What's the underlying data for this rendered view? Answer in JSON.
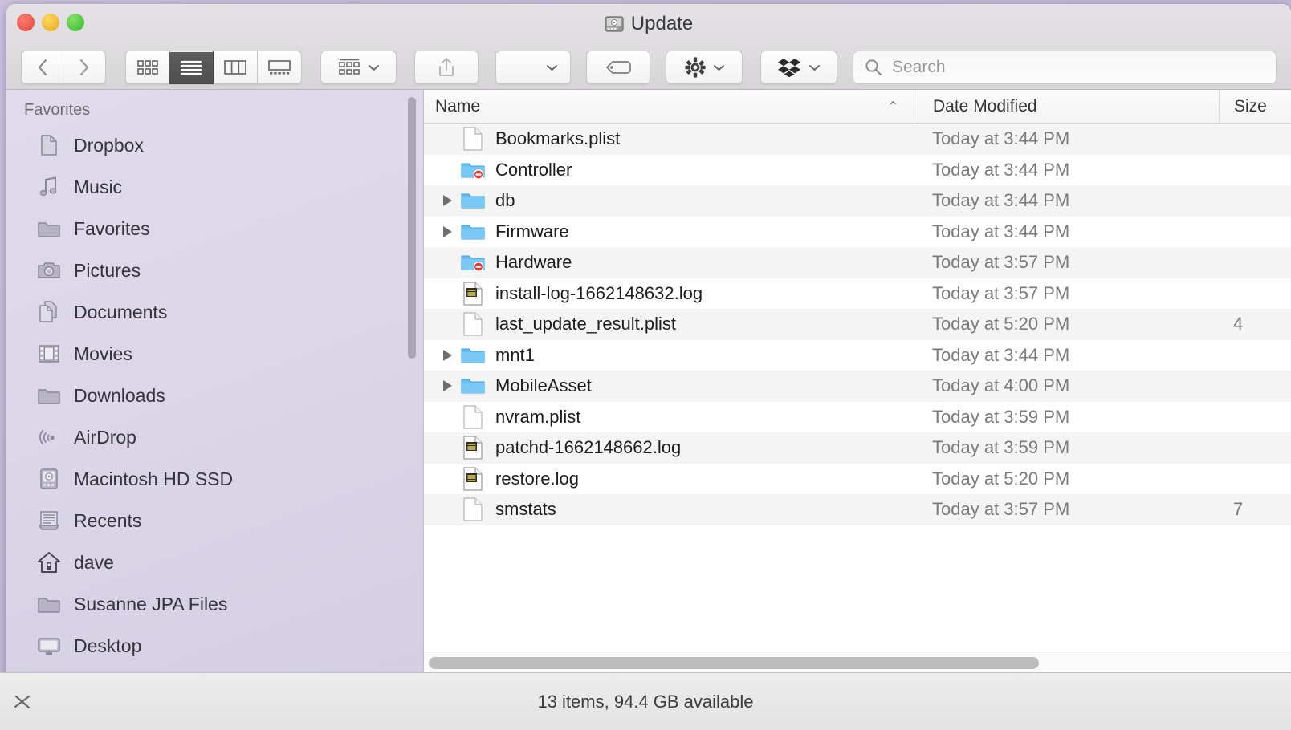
{
  "window": {
    "title": "Update",
    "title_icon": "hard-drive-icon",
    "traffic_lights": [
      "close",
      "minimize",
      "zoom"
    ]
  },
  "toolbar": {
    "back_label": "‹",
    "forward_label": "›",
    "view_modes": [
      {
        "name": "icon-view",
        "active": false
      },
      {
        "name": "list-view",
        "active": true
      },
      {
        "name": "column-view",
        "active": false
      },
      {
        "name": "gallery-view",
        "active": false
      }
    ],
    "arrange_label": "",
    "share_label": "",
    "action_label": "",
    "tag_label": "",
    "gear_label": "",
    "dropbox_label": "",
    "search_placeholder": "Search",
    "search_value": ""
  },
  "sidebar": {
    "section_label": "Favorites",
    "items": [
      {
        "label": "Dropbox",
        "icon": "document-icon"
      },
      {
        "label": "Music",
        "icon": "music-note-icon"
      },
      {
        "label": "Favorites",
        "icon": "folder-icon"
      },
      {
        "label": "Pictures",
        "icon": "camera-icon"
      },
      {
        "label": "Documents",
        "icon": "documents-icon"
      },
      {
        "label": "Movies",
        "icon": "film-icon"
      },
      {
        "label": "Downloads",
        "icon": "folder-icon"
      },
      {
        "label": "AirDrop",
        "icon": "airdrop-icon"
      },
      {
        "label": "Macintosh HD SSD",
        "icon": "hard-drive-icon"
      },
      {
        "label": "Recents",
        "icon": "recents-icon"
      },
      {
        "label": "dave",
        "icon": "home-icon"
      },
      {
        "label": "Susanne JPA Files",
        "icon": "folder-icon"
      },
      {
        "label": "Desktop",
        "icon": "desktop-icon"
      }
    ]
  },
  "file_list": {
    "columns": [
      {
        "label": "Name",
        "sorted": true,
        "sort_direction": "ascending"
      },
      {
        "label": "Date Modified",
        "sorted": false
      },
      {
        "label": "Size",
        "sorted": false
      }
    ],
    "sort_arrow": "⌃",
    "rows": [
      {
        "name": "Bookmarks.plist",
        "icon": "plist-document-icon",
        "expandable": false,
        "date": "Today at 3:44 PM",
        "size": ""
      },
      {
        "name": "Controller",
        "icon": "folder-no-access-icon",
        "expandable": false,
        "date": "Today at 3:44 PM",
        "size": ""
      },
      {
        "name": "db",
        "icon": "folder-icon",
        "expandable": true,
        "date": "Today at 3:44 PM",
        "size": ""
      },
      {
        "name": "Firmware",
        "icon": "folder-icon",
        "expandable": true,
        "date": "Today at 3:44 PM",
        "size": ""
      },
      {
        "name": "Hardware",
        "icon": "folder-no-access-icon",
        "expandable": false,
        "date": "Today at 3:57 PM",
        "size": ""
      },
      {
        "name": "install-log-1662148632.log",
        "icon": "log-document-icon",
        "expandable": false,
        "date": "Today at 3:57 PM",
        "size": ""
      },
      {
        "name": "last_update_result.plist",
        "icon": "plist-document-icon",
        "expandable": false,
        "date": "Today at 5:20 PM",
        "size": "4"
      },
      {
        "name": "mnt1",
        "icon": "folder-icon",
        "expandable": true,
        "date": "Today at 3:44 PM",
        "size": ""
      },
      {
        "name": "MobileAsset",
        "icon": "folder-icon",
        "expandable": true,
        "date": "Today at 4:00 PM",
        "size": ""
      },
      {
        "name": "nvram.plist",
        "icon": "plist-document-icon",
        "expandable": false,
        "date": "Today at 3:59 PM",
        "size": ""
      },
      {
        "name": "patchd-1662148662.log",
        "icon": "log-document-icon",
        "expandable": false,
        "date": "Today at 3:59 PM",
        "size": ""
      },
      {
        "name": "restore.log",
        "icon": "log-document-icon",
        "expandable": false,
        "date": "Today at 5:20 PM",
        "size": ""
      },
      {
        "name": "smstats",
        "icon": "plist-document-icon",
        "expandable": false,
        "date": "Today at 3:57 PM",
        "size": "7"
      }
    ]
  },
  "path_bar": {
    "label": "Update",
    "icon": "hard-drive-icon"
  },
  "status_bar": {
    "text": "13 items, 94.4 GB available",
    "tool_icon": "markup-tool-icon"
  },
  "colors": {
    "folder_blue": "#63bdf2",
    "badge_red": "#e03b33",
    "accent_selected": "#545454",
    "sidebar_tint": "#ded8ea"
  }
}
